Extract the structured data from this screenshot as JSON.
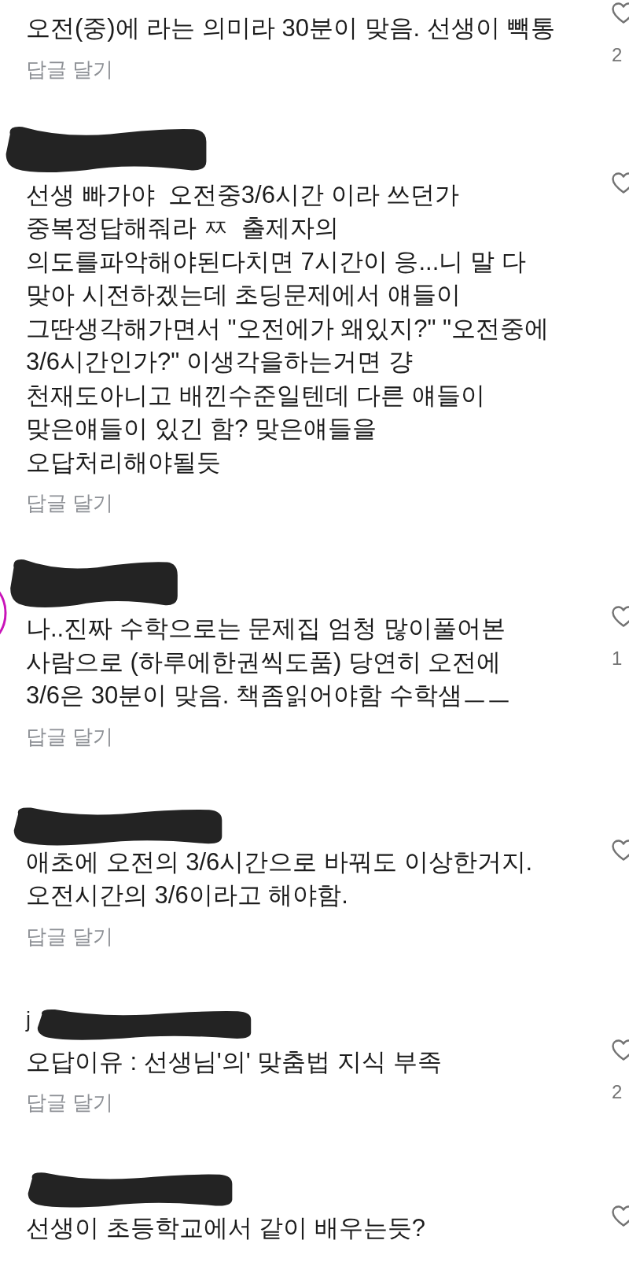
{
  "comments": [
    {
      "text": "오전(중)에 라는 의미라 30분이 맞음. 선생이 빽통",
      "reply_label": "답글 달기",
      "likes": "2",
      "liked": false,
      "redacted": false,
      "has_story": false
    },
    {
      "text": "선생 빠가야  오전중3/6시간 이라 쓰던가\n중복정답해줘라 ㅉ  출제자의\n의도를파악해야된다치면 7시간이 응...니 말 다\n맞아 시전하겠는데 초딩문제에서 얘들이\n그딴생각해가면서 \"오전에가 왜있지?\" \"오전중에\n3/6시간인가?\" 이생각을하는거면 걍\n천재도아니고 배낀수준일텐데 다른 얘들이\n맞은얘들이 있긴 함? 맞은얘들을\n오답처리해야될듯",
      "reply_label": "답글 달기",
      "liked": false,
      "redacted": true,
      "has_story": false
    },
    {
      "text": "나..진짜 수학으로는 문제집 엄청 많이풀어본\n사람으로 (하루에한권씩도품) 당연히 오전에\n3/6은 30분이 맞음. 책좀읽어야함 수학샘ㅡㅡ",
      "reply_label": "답글 달기",
      "likes": "1",
      "liked": false,
      "redacted": true,
      "has_story": true
    },
    {
      "text": "애초에 오전의 3/6시간으로 바꿔도 이상한거지.\n오전시간의 3/6이라고 해야함.",
      "reply_label": "답글 달기",
      "liked": false,
      "redacted": true,
      "has_story": false
    },
    {
      "username": "j",
      "text": "오답이유 : 선생님'의' 맞춤법 지식 부족",
      "reply_label": "답글 달기",
      "likes": "2",
      "liked": false,
      "redacted": true,
      "has_story": false
    },
    {
      "text": "선생이 초등학교에서 같이 배우는듯?",
      "liked": false,
      "redacted": true,
      "has_story": false
    }
  ]
}
